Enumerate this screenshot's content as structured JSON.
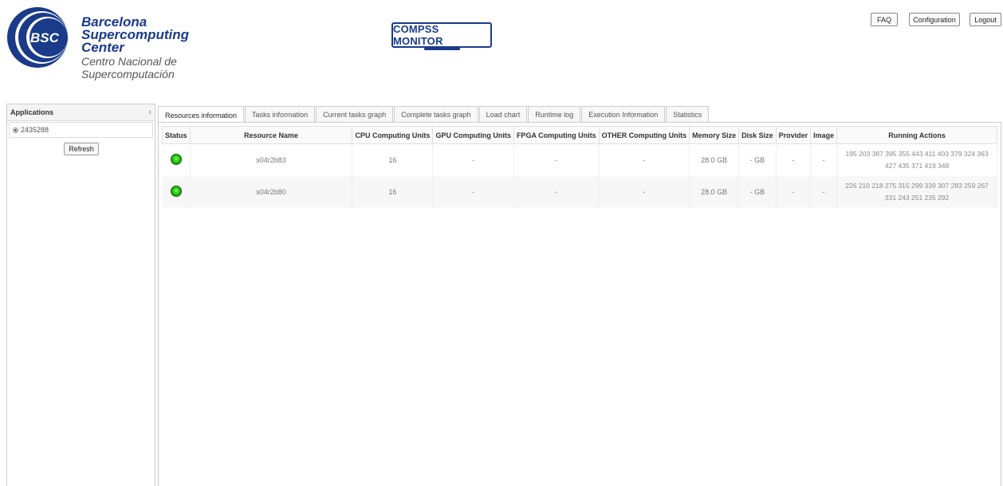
{
  "header": {
    "logo": {
      "badge": "BSC",
      "lines": [
        "Barcelona",
        "Supercomputing",
        "Center"
      ],
      "subtitle": "Centro Nacional de Supercomputación"
    },
    "monitor_logo": "COMPSS MONITOR",
    "buttons": {
      "faq": "FAQ",
      "configuration": "Configuration",
      "logout": "Logout"
    }
  },
  "sidebar": {
    "title": "Applications",
    "applications": [
      {
        "id": "2435288"
      }
    ],
    "refresh_label": "Refresh"
  },
  "tabs": [
    {
      "label": "Resources information",
      "active": true
    },
    {
      "label": "Tasks information"
    },
    {
      "label": "Current tasks graph"
    },
    {
      "label": "Complete tasks graph"
    },
    {
      "label": "Load chart"
    },
    {
      "label": "Runtime log"
    },
    {
      "label": "Execution Information"
    },
    {
      "label": "Statistics"
    }
  ],
  "table": {
    "columns": [
      "Status",
      "Resource Name",
      "CPU Computing Units",
      "GPU Computing Units",
      "FPGA Computing Units",
      "OTHER Computing Units",
      "Memory Size",
      "Disk Size",
      "Provider",
      "Image",
      "Running Actions"
    ],
    "rows": [
      {
        "status": "running",
        "resource_name": "s04r2b83",
        "cpu": "16",
        "gpu": "-",
        "fpga": "-",
        "other": "-",
        "memory": "28.0 GB",
        "disk": "- GB",
        "provider": "-",
        "image": "-",
        "running_actions": "195 203 387 395 355 443 411 403 379 324 363 427 435 371 419 348"
      },
      {
        "status": "running",
        "resource_name": "s04r2b80",
        "cpu": "16",
        "gpu": "-",
        "fpga": "-",
        "other": "-",
        "memory": "28.0 GB",
        "disk": "- GB",
        "provider": "-",
        "image": "-",
        "running_actions": "226 210 218 275 315 299 339 307 283 259 267 331 243 251 235 292"
      }
    ]
  },
  "colors": {
    "brand_blue": "#1a3a8a",
    "status_green": "#2fd41c"
  }
}
